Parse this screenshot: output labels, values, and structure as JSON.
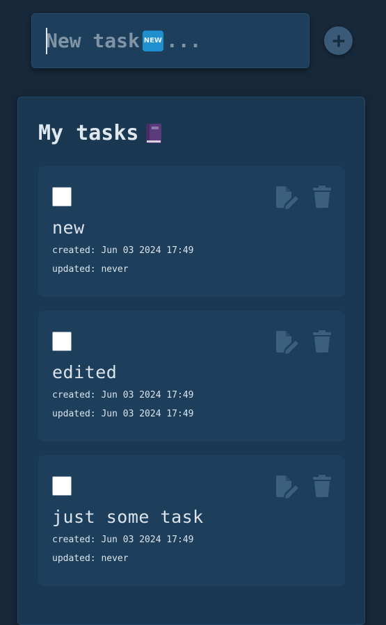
{
  "new_task": {
    "placeholder_prefix": "New task",
    "badge_text": "NEW",
    "placeholder_suffix": "...",
    "add_button_label": "+"
  },
  "panel": {
    "title": "My tasks"
  },
  "tasks": [
    {
      "title": "new",
      "created": "created: Jun 03 2024 17:49",
      "updated": "updated: never",
      "completed": false
    },
    {
      "title": "edited",
      "created": "created: Jun 03 2024 17:49",
      "updated": "updated: Jun 03 2024 17:49",
      "completed": false
    },
    {
      "title": "just some task",
      "created": "created: Jun 03 2024 17:49",
      "updated": "updated: never",
      "completed": false
    }
  ],
  "icons": {
    "add": "plus-icon",
    "panel": "book-icon",
    "edit": "edit-document-icon",
    "delete": "trash-icon"
  },
  "colors": {
    "background": "#16283a",
    "panel": "#1b3852",
    "card": "#1e3f5c",
    "text": "#dbe3eb",
    "placeholder": "#8194a6",
    "icon_muted": "#3d5f7e",
    "badge": "#1f8fd0"
  }
}
